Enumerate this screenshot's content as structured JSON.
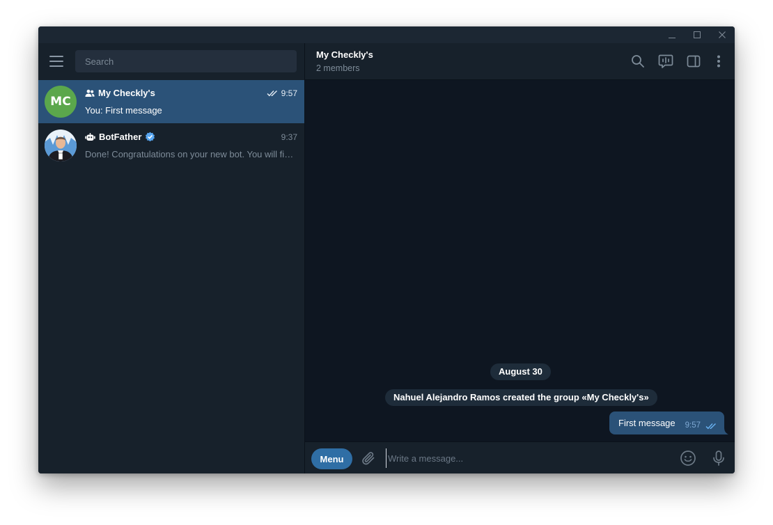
{
  "window": {
    "controls": [
      {
        "name": "minimize-button",
        "icon": "minimize-icon"
      },
      {
        "name": "maximize-button",
        "icon": "maximize-icon"
      },
      {
        "name": "close-button",
        "icon": "close-icon"
      }
    ]
  },
  "sidebar": {
    "search_placeholder": "Search",
    "chats": [
      {
        "avatar_initials": "MC",
        "avatar_color": "#5ba74c",
        "type_icon": "group-icon",
        "title": "My Checkly's",
        "time": "9:57",
        "status_icon": "double-check-icon",
        "preview": "You: First message",
        "active": true
      },
      {
        "avatar_icon": "botfather-avatar",
        "type_icon": "bot-icon",
        "title": "BotFather",
        "verified_icon": "verified-badge-icon",
        "time": "9:37",
        "preview": "Done! Congratulations on your new bot. You will find it at t.me/",
        "active": false
      }
    ]
  },
  "header": {
    "title": "My Checkly's",
    "subtitle": "2 members",
    "icons": [
      "search-icon",
      "voice-chat-icon",
      "sidebar-toggle-icon",
      "more-vertical-icon"
    ]
  },
  "history": {
    "date_separator": "August 30",
    "service_message": "Nahuel Alejandro Ramos created the group «My Checkly's»",
    "messages": [
      {
        "text": "First message",
        "time": "9:57",
        "status_icon": "double-check-icon",
        "outgoing": true
      }
    ]
  },
  "composer": {
    "menu_label": "Menu",
    "placeholder": "Write a message...",
    "icons": [
      "attach-icon",
      "emoji-icon",
      "microphone-icon"
    ]
  },
  "colors": {
    "accent": "#2b5278",
    "menu_button": "#2f6ea5",
    "sidebar_bg": "#17212b",
    "history_bg": "#0e1621",
    "verified": "#58a6f0"
  }
}
